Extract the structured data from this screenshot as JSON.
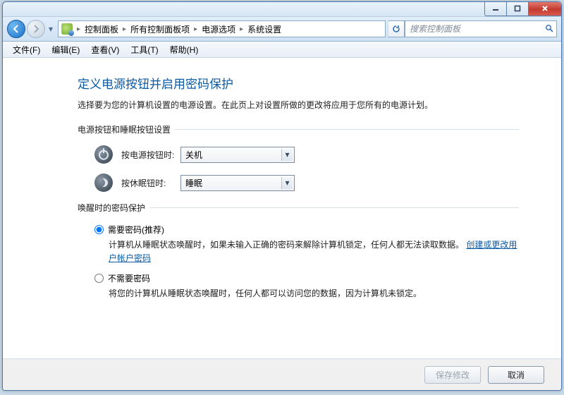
{
  "window_controls": {
    "minimize": "–",
    "maximize": "□",
    "close": "×"
  },
  "breadcrumb": {
    "items": [
      "控制面板",
      "所有控制面板项",
      "电源选项",
      "系统设置"
    ]
  },
  "search": {
    "placeholder": "搜索控制面板"
  },
  "menu": {
    "file": "文件(F)",
    "edit": "编辑(E)",
    "view": "查看(V)",
    "tools": "工具(T)",
    "help": "帮助(H)"
  },
  "page": {
    "heading": "定义电源按钮并启用密码保护",
    "subtitle": "选择要为您的计算机设置的电源设置。在此页上对设置所做的更改将应用于您所有的电源计划。",
    "section1_label": "电源按钮和睡眠按钮设置",
    "power_label": "按电源按钮时:",
    "power_value": "关机",
    "sleep_label": "按休眠钮时:",
    "sleep_value": "睡眠",
    "section2_label": "唤醒时的密码保护",
    "opt1_label": "需要密码(推荐)",
    "opt1_desc_a": "计算机从睡眠状态唤醒时，如果未输入正确的密码来解除计算机锁定，任何人都无法读取数据。",
    "opt1_link": "创建或更改用户帐户密码",
    "opt2_label": "不需要密码",
    "opt2_desc": "将您的计算机从睡眠状态唤醒时，任何人都可以访问您的数据，因为计算机未锁定。"
  },
  "footer": {
    "save": "保存修改",
    "cancel": "取消"
  }
}
